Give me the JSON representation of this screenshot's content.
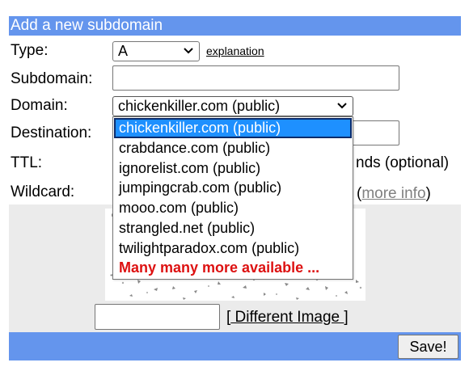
{
  "form": {
    "title": "Add a new subdomain",
    "type_label": "Type:",
    "type_value": "A",
    "explanation_link": "explanation",
    "subdomain_label": "Subdomain:",
    "subdomain_value": "",
    "domain_label": "Domain:",
    "domain_value": "chickenkiller.com (public)",
    "destination_label": "Destination:",
    "destination_value": "",
    "ttl_label": "TTL:",
    "ttl_suffix": "nds (optional)",
    "wildcard_label": "Wildcard:",
    "wildcard_more_info_open": "(",
    "wildcard_more_info_link": "more info",
    "wildcard_more_info_close": ")"
  },
  "captcha": {
    "input_value": "",
    "different_image_open": "[",
    "different_image_link": " Different Image ",
    "different_image_close": "]"
  },
  "footer": {
    "save_label": "Save!"
  },
  "domain_dropdown": {
    "options": [
      {
        "label": "chickenkiller.com (public)"
      },
      {
        "label": "crabdance.com (public)"
      },
      {
        "label": "ignorelist.com (public)"
      },
      {
        "label": "jumpingcrab.com (public)"
      },
      {
        "label": "mooo.com (public)"
      },
      {
        "label": "strangled.net (public)"
      },
      {
        "label": "twilightparadox.com (public)"
      },
      {
        "label": "Many many more available ..."
      }
    ],
    "selected_index": 0
  },
  "colors": {
    "header_bg": "#6495ed",
    "selected_option_bg": "#1e90ff",
    "more_available_text": "#dd1111"
  }
}
